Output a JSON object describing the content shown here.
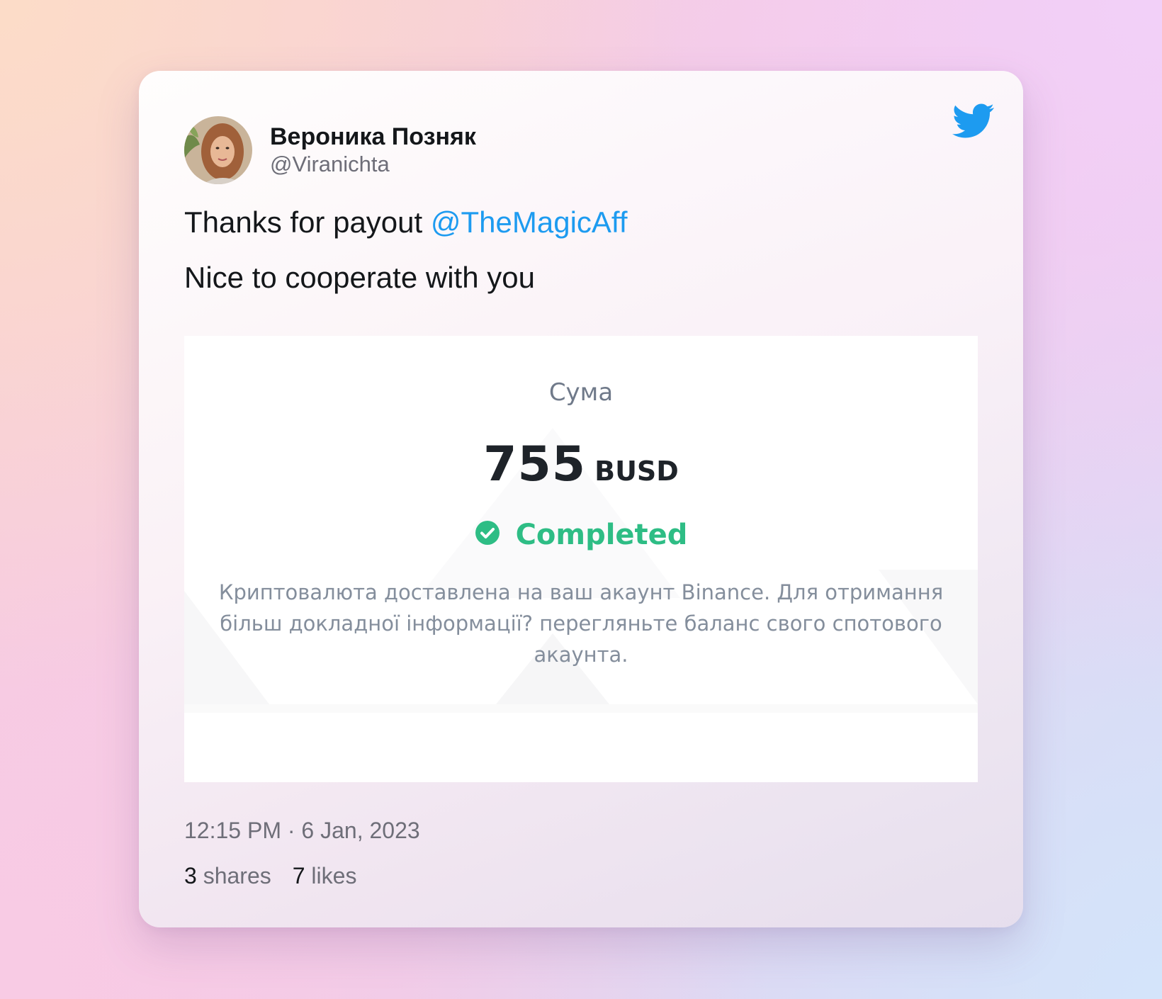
{
  "tweet": {
    "author": {
      "display_name": "Вероника Позняк",
      "handle": "@Viranichta"
    },
    "text_prefix": "Thanks for payout ",
    "mention": "@TheMagicAff",
    "text_line2": "Nice to cooperate with you",
    "timestamp": "12:15 PM · 6 Jan, 2023",
    "shares_count": "3",
    "shares_label": "shares",
    "likes_count": "7",
    "likes_label": "likes",
    "icons": {
      "brand": "twitter-bird-icon",
      "status": "check-circle-icon"
    },
    "colors": {
      "mention": "#1d9bf0",
      "twitter_blue": "#1d9bf0",
      "status_green": "#2ebd85"
    }
  },
  "media": {
    "amount_label": "Сума",
    "amount_value": "755",
    "amount_unit": "BUSD",
    "status": "Completed",
    "description": "Криптовалюта доставлена на ваш акаунт Binance. Для отримання більш докладної інформації? перегляньте баланс свого спотового акаунта."
  }
}
